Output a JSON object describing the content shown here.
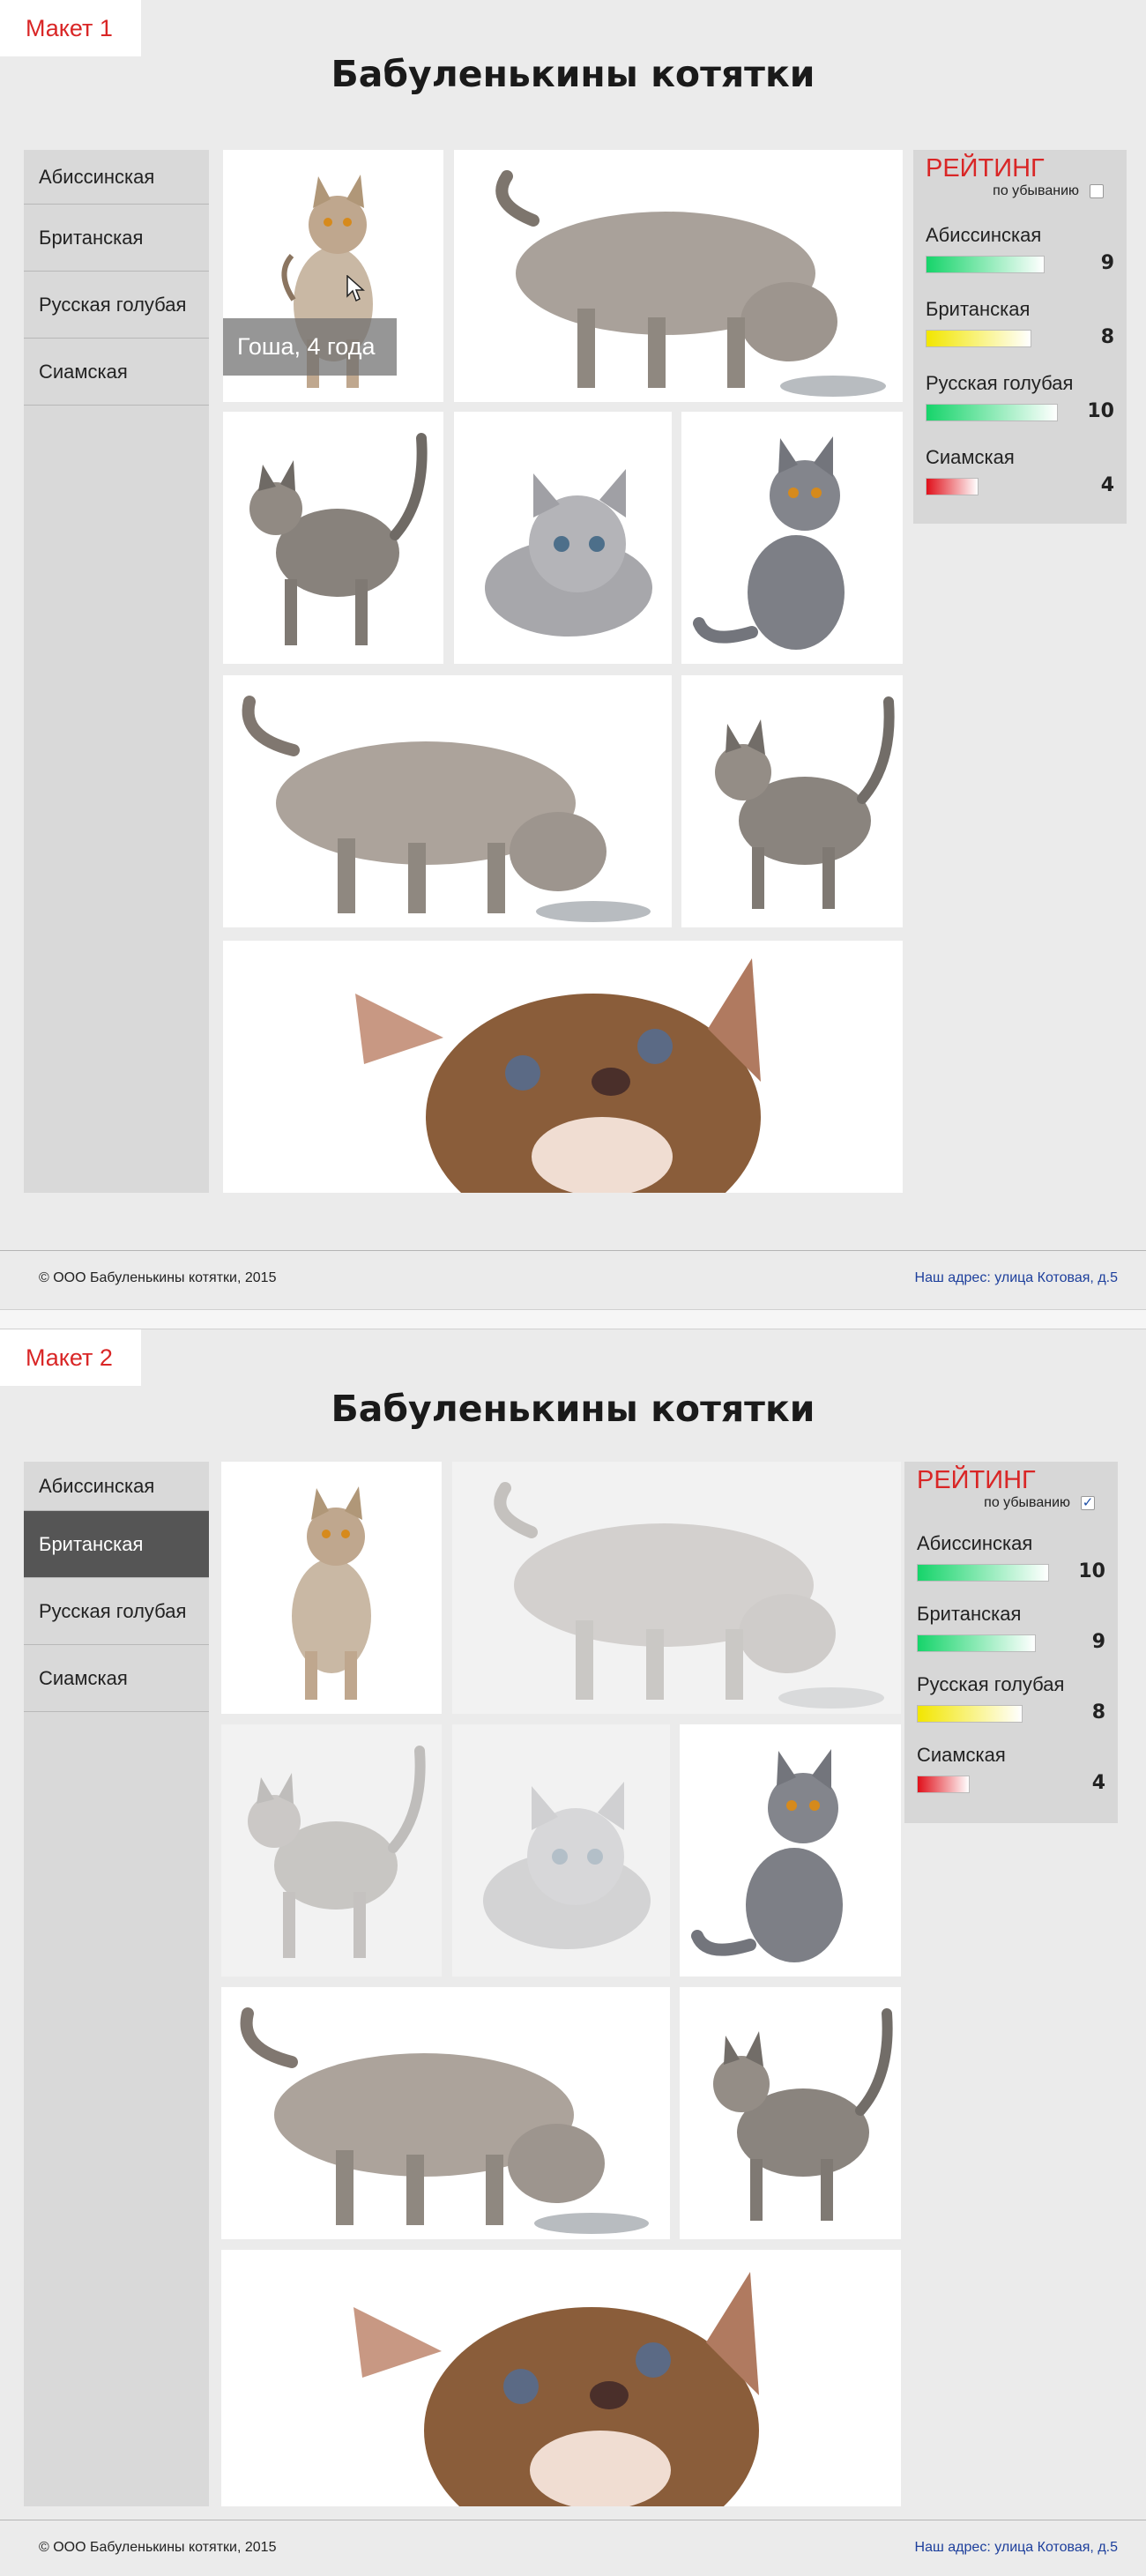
{
  "mockups": [
    {
      "tag": "Макет 1",
      "title": "Бабуленькины котятки",
      "menu": [
        {
          "label": "Абиссинская",
          "active": false
        },
        {
          "label": "Британская",
          "active": false
        },
        {
          "label": "Русская голубая",
          "active": false
        },
        {
          "label": "Сиамская",
          "active": false
        }
      ],
      "caption": "Гоша, 4 года",
      "rating": {
        "title": "РЕЙТИНГ",
        "sort_label": "по убыванию",
        "sort_checked": false,
        "items": [
          {
            "name": "Абиссинская",
            "value": "9",
            "level": 0.9,
            "color": "green"
          },
          {
            "name": "Британская",
            "value": "8",
            "level": 0.8,
            "color": "yellow"
          },
          {
            "name": "Русская голубая",
            "value": "10",
            "level": 1.0,
            "color": "green"
          },
          {
            "name": "Сиамская",
            "value": "4",
            "level": 0.4,
            "color": "red"
          }
        ]
      },
      "footer": {
        "copyright": "© ООО Бабуленькины котятки, 2015",
        "address": "Наш адрес: улица Котовая, д.5"
      }
    },
    {
      "tag": "Макет 2",
      "title": "Бабуленькины котятки",
      "menu": [
        {
          "label": "Абиссинская",
          "active": false
        },
        {
          "label": "Британская",
          "active": true
        },
        {
          "label": "Русская голубая",
          "active": false
        },
        {
          "label": "Сиамская",
          "active": false
        }
      ],
      "rating": {
        "title": "РЕЙТИНГ",
        "sort_label": "по убыванию",
        "sort_checked": true,
        "items": [
          {
            "name": "Абиссинская",
            "value": "10",
            "level": 1.0,
            "color": "green"
          },
          {
            "name": "Британская",
            "value": "9",
            "level": 0.9,
            "color": "green"
          },
          {
            "name": "Русская голубая",
            "value": "8",
            "level": 0.8,
            "color": "yellow"
          },
          {
            "name": "Сиамская",
            "value": "4",
            "level": 0.4,
            "color": "red"
          }
        ]
      },
      "footer": {
        "copyright": "© ООО Бабуленькины котятки, 2015",
        "address": "Наш адрес: улица Котовая, д.5"
      }
    }
  ],
  "colors": {
    "accent": "#d92626",
    "link": "#1d3f9c",
    "active_menu": "#555555",
    "panel": "#d9d9d9"
  },
  "bar_gradients": {
    "green": "#16d46a",
    "yellow": "#f2e600",
    "red": "#e0101a"
  }
}
